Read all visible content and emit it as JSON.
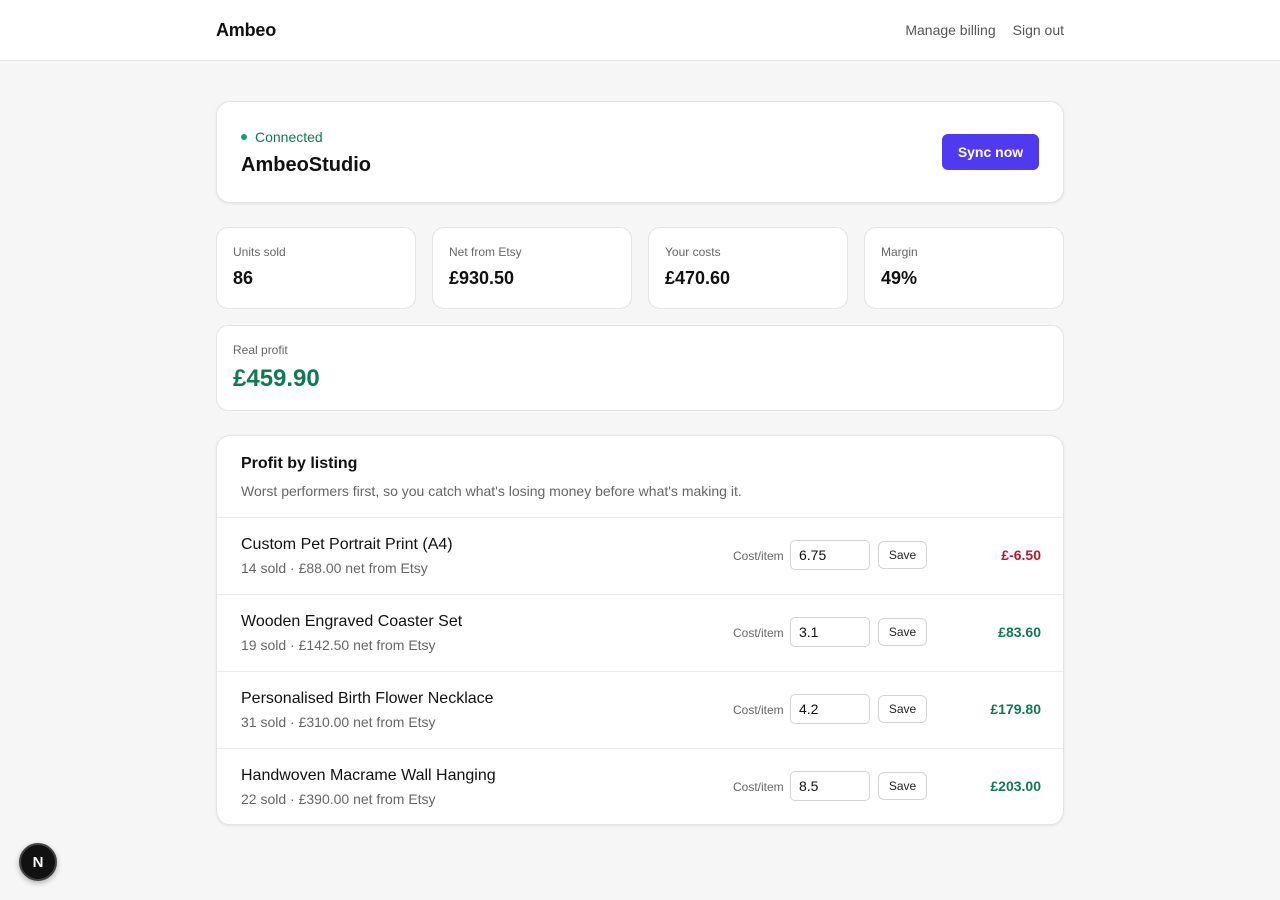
{
  "header": {
    "brand": "Ambeo",
    "nav": {
      "manage_billing": "Manage billing",
      "sign_out": "Sign out"
    }
  },
  "shop": {
    "status": "Connected",
    "name": "AmbeoStudio",
    "sync_label": "Sync now"
  },
  "stats": [
    {
      "label": "Units sold",
      "value": "86"
    },
    {
      "label": "Net from Etsy",
      "value": "£930.50"
    },
    {
      "label": "Your costs",
      "value": "£470.60"
    },
    {
      "label": "Margin",
      "value": "49%"
    }
  ],
  "real_profit": {
    "label": "Real profit",
    "value": "£459.90"
  },
  "listings": {
    "title": "Profit by listing",
    "subtitle": "Worst performers first, so you catch what's losing money before what's making it.",
    "cost_label": "Cost/item",
    "save_label": "Save",
    "rows": [
      {
        "name": "Custom Pet Portrait Print (A4)",
        "meta": "14 sold · £88.00 net from Etsy",
        "cost": "6.75",
        "profit": "£-6.50",
        "profit_color": "#c0122d"
      },
      {
        "name": "Wooden Engraved Coaster Set",
        "meta": "19 sold · £142.50 net from Etsy",
        "cost": "3.1",
        "profit": "£83.60",
        "profit_color": "#0f7a52"
      },
      {
        "name": "Personalised Birth Flower Necklace",
        "meta": "31 sold · £310.00 net from Etsy",
        "cost": "4.2",
        "profit": "£179.80",
        "profit_color": "#0f7a52"
      },
      {
        "name": "Handwoven Macrame Wall Hanging",
        "meta": "22 sold · £390.00 net from Etsy",
        "cost": "8.5",
        "profit": "£203.00",
        "profit_color": "#0f7a52"
      }
    ]
  },
  "fab": {
    "letter": "N"
  },
  "colors": {
    "accent": "#4f3af0",
    "positive": "#0f7a52",
    "negative": "#c0122d"
  }
}
